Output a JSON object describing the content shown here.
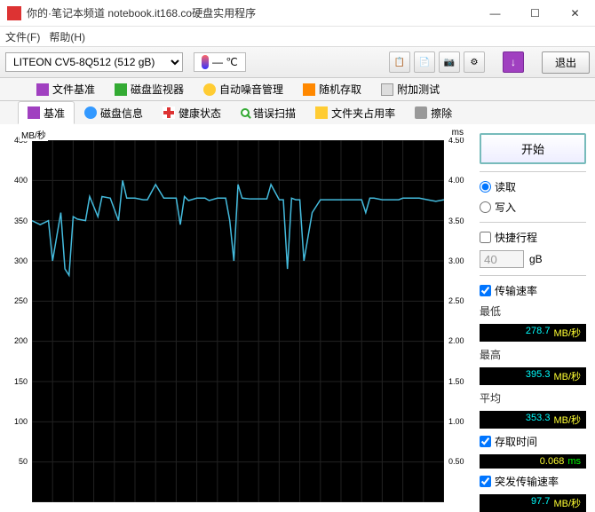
{
  "window": {
    "title": "你的·笔记本频道 notebook.it168.co硬盘实用程序",
    "min": "—",
    "max": "☐",
    "close": "✕"
  },
  "menu": {
    "file": "文件(F)",
    "help": "帮助(H)"
  },
  "toolbar": {
    "drive": "LITEON CV5-8Q512 (512 gB)",
    "temp": "— ℃",
    "exit": "退出"
  },
  "tabs1": {
    "benchmark": "文件基准",
    "monitor": "磁盘监视器",
    "aam": "自动噪音管理",
    "random": "随机存取",
    "extra": "附加测试"
  },
  "tabs2": {
    "benchmark": "基准",
    "info": "磁盘信息",
    "health": "健康状态",
    "errscan": "错误扫描",
    "folder": "文件夹占用率",
    "erase": "擦除"
  },
  "chart": {
    "yaxis_left_label": "MB/秒",
    "yaxis_right_label": "ms",
    "left_ticks": [
      "450",
      "400",
      "350",
      "300",
      "250",
      "200",
      "150",
      "100",
      "50"
    ],
    "right_ticks": [
      "4.50",
      "4.00",
      "3.50",
      "3.00",
      "2.50",
      "2.00",
      "1.50",
      "1.00",
      "0.50"
    ]
  },
  "chart_data": {
    "type": "line",
    "title": "",
    "xlabel": "",
    "ylabel_left": "MB/秒",
    "ylabel_right": "ms",
    "ylim_left": [
      0,
      450
    ],
    "ylim_right": [
      0,
      4.5
    ],
    "series": [
      {
        "name": "传输速率",
        "axis": "left",
        "unit": "MB/秒",
        "x": [
          0,
          2,
          4,
          5,
          7,
          8,
          9,
          10,
          11,
          13,
          14,
          16,
          17,
          19,
          21,
          22,
          23,
          25,
          27,
          28,
          30,
          32,
          33,
          35,
          36,
          37,
          38,
          40,
          42,
          43,
          45,
          47,
          48,
          49,
          50,
          51,
          53,
          55,
          57,
          58,
          60,
          61,
          62,
          63,
          64,
          65,
          66,
          68,
          70,
          71,
          73,
          75,
          77,
          79,
          80,
          81,
          82,
          83,
          85,
          87,
          89,
          90,
          92,
          94,
          96,
          98,
          100
        ],
        "values": [
          350,
          345,
          350,
          300,
          360,
          290,
          282,
          355,
          352,
          350,
          380,
          355,
          380,
          378,
          350,
          400,
          378,
          378,
          376,
          376,
          395,
          378,
          378,
          378,
          345,
          380,
          375,
          378,
          378,
          375,
          378,
          378,
          350,
          300,
          395,
          378,
          377,
          377,
          377,
          395,
          376,
          376,
          290,
          378,
          376,
          376,
          300,
          360,
          376,
          376,
          376,
          376,
          376,
          376,
          376,
          360,
          378,
          378,
          376,
          376,
          376,
          378,
          378,
          378,
          376,
          374,
          376
        ]
      }
    ]
  },
  "side": {
    "start": "开始",
    "read": "读取",
    "write": "写入",
    "short": "快捷行程",
    "short_val": "40",
    "gb": "gB",
    "rate_chk": "传输速率",
    "min_lbl": "最低",
    "min_val": "278.7",
    "unit_rate": "MB/秒",
    "max_lbl": "最高",
    "max_val": "395.3",
    "avg_lbl": "平均",
    "avg_val": "353.3",
    "access_chk": "存取时间",
    "access_val": "0.068",
    "unit_ms": "ms",
    "burst_chk": "突发传输速率",
    "burst_val": "97.7"
  }
}
